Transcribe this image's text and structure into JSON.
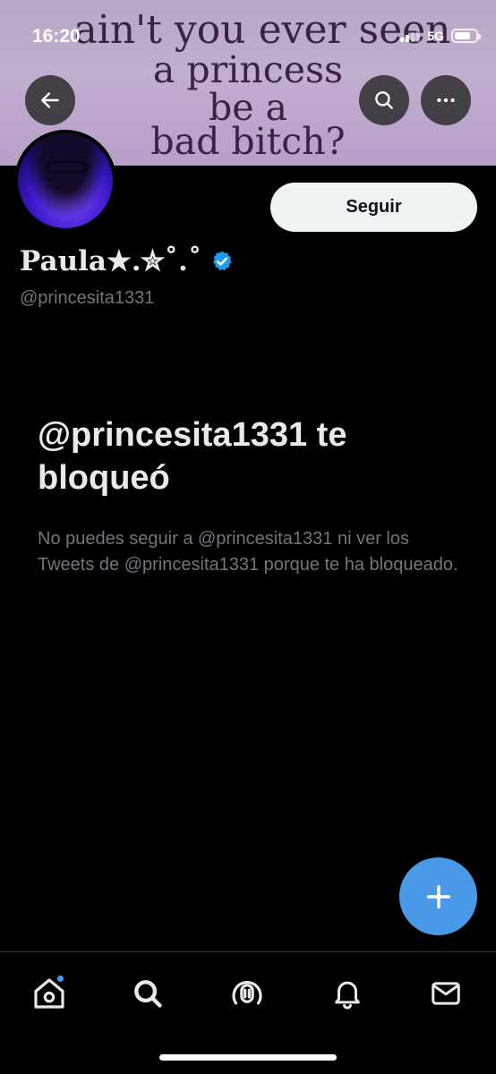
{
  "status_bar": {
    "time": "16:20",
    "network": "5G",
    "battery_level": 0.75
  },
  "banner": {
    "lines": [
      "ain't you ever seen",
      "a princess",
      "be a",
      "bad bitch?"
    ]
  },
  "header": {
    "back_icon": "arrow-left-icon",
    "search_icon": "search-icon",
    "more_icon": "more-horizontal-icon"
  },
  "profile": {
    "display_name": "Paula★.✮˚.˚",
    "handle": "@princesita1331",
    "verified": true,
    "follow_label": "Seguir"
  },
  "blocked": {
    "title": "@princesita1331 te bloqueó",
    "description": "No puedes seguir a @princesita1331 ni ver los Tweets de @princesita1331 porque te ha bloqueado."
  },
  "fab": {
    "icon": "plus-icon"
  },
  "bottom_nav": {
    "items": [
      {
        "icon": "home-icon",
        "has_badge": true
      },
      {
        "icon": "search-icon",
        "has_badge": false
      },
      {
        "icon": "spaces-icon",
        "has_badge": false
      },
      {
        "icon": "bell-icon",
        "has_badge": false
      },
      {
        "icon": "mail-icon",
        "has_badge": false
      }
    ]
  },
  "colors": {
    "accent": "#4a99e9",
    "background": "#000000",
    "text_primary": "#e7e9ea",
    "text_secondary": "#71767b",
    "banner": "#c2aecf"
  }
}
